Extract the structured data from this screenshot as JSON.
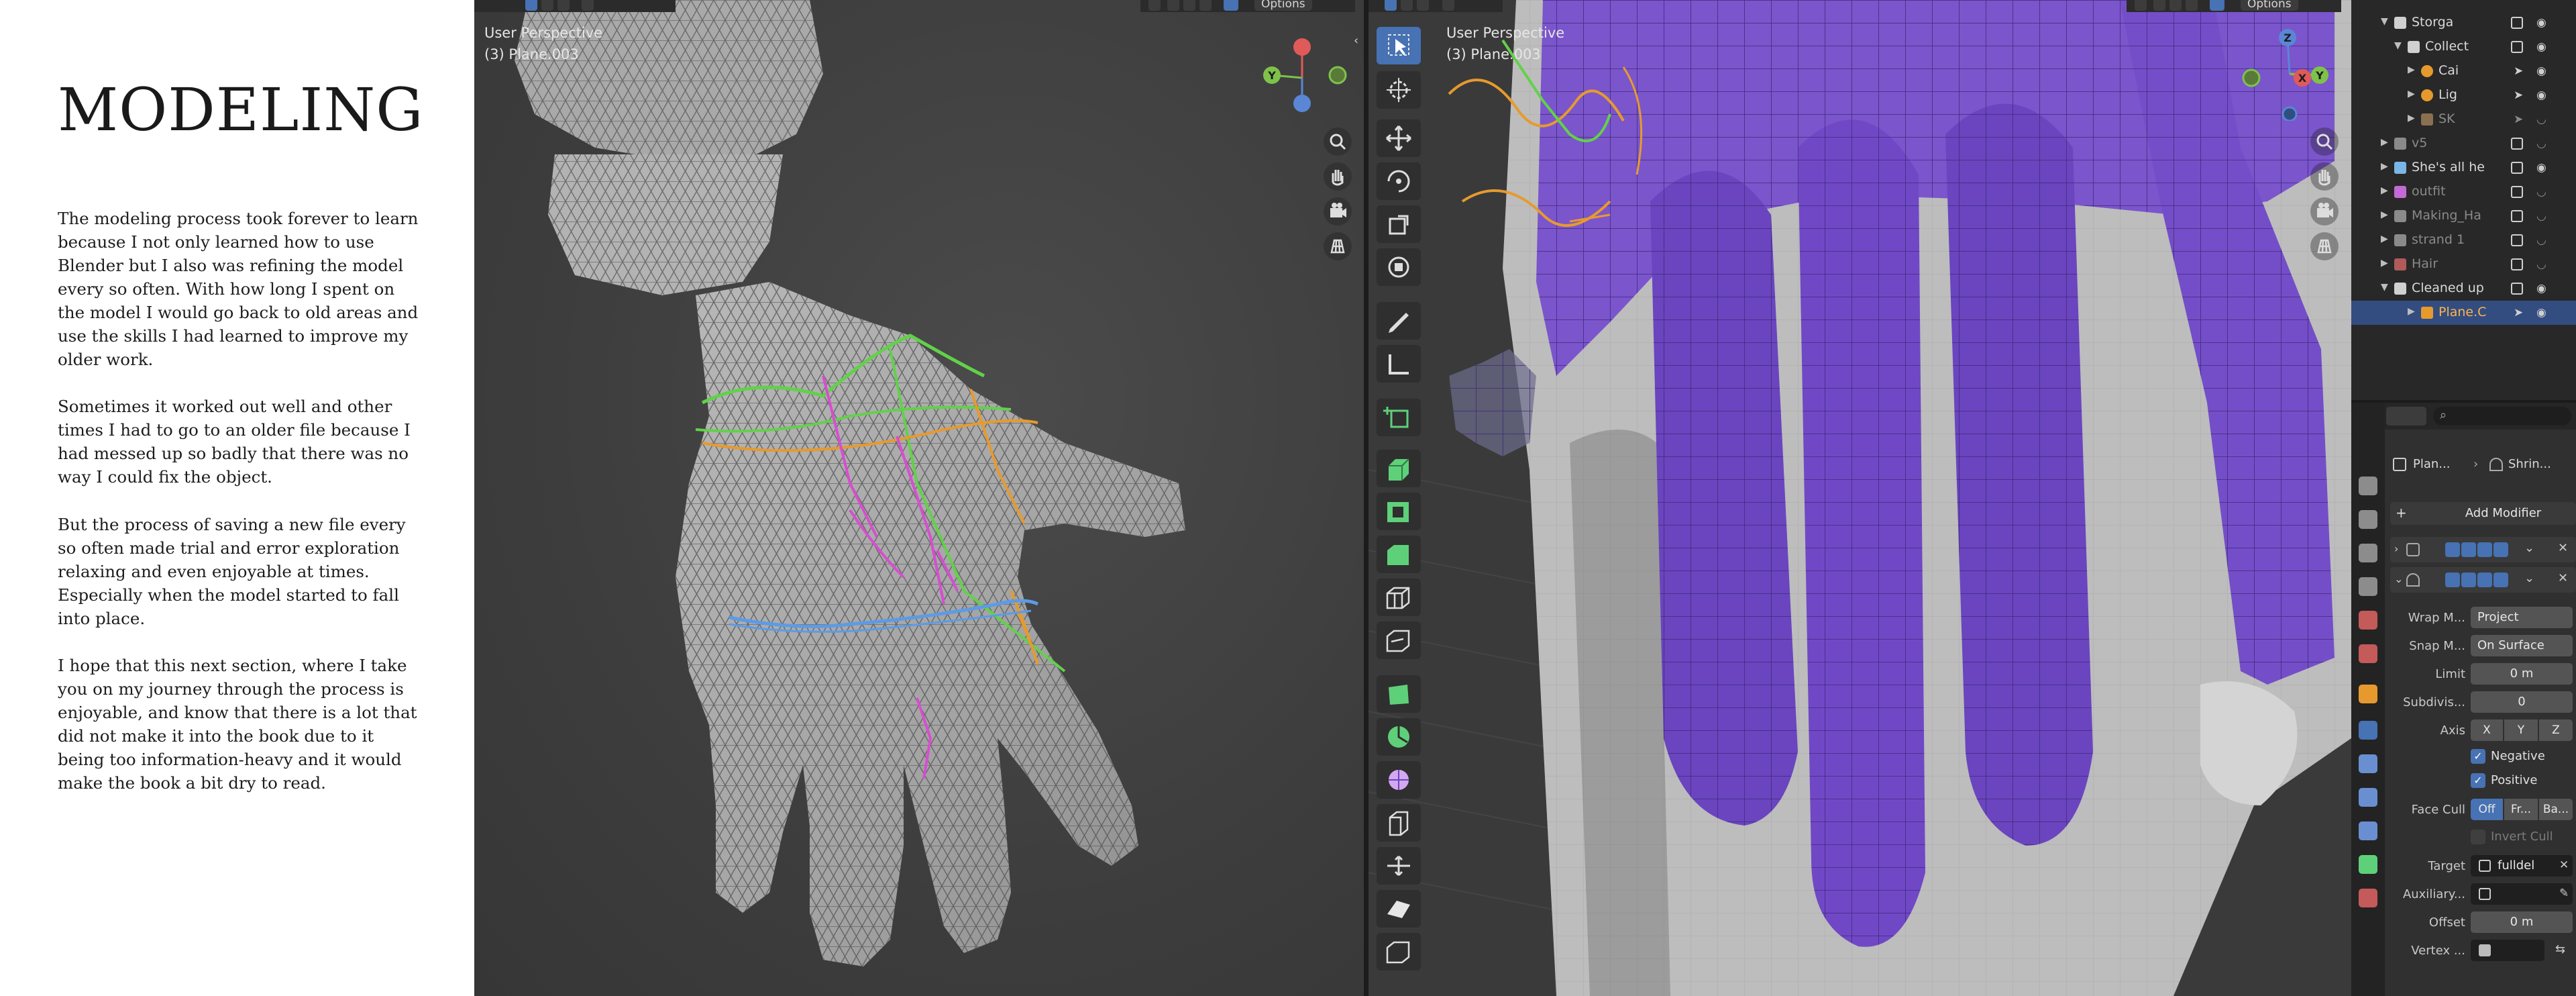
{
  "page": {
    "heading": "MODELING",
    "paragraphs": [
      "The modeling process took forever to learn because I not only learned how to use Blender but I also was refining the model every so often. With how long I spent on the model I would go back to old areas and use the skills I had learned to improve my older work.",
      "Sometimes it worked out well and other times I had to go to an older file because I had messed up so badly that there was no way I could fix the object.",
      "But the process of saving a new file every so often made trial and error exploration relaxing and even enjoyable at times. Especially when the model started to fall into place.",
      "I hope that this next section, where I take you on my journey through the process is enjoyable, and know that there is a lot that did not make it into the book due to it being too information-heavy and it would make the book a bit dry to read."
    ]
  },
  "viewport_left": {
    "perspective": "User Perspective",
    "object": "(3) Plane.003",
    "options_label": "Options",
    "gizmo_labels": {
      "y": "Y"
    }
  },
  "viewport_right": {
    "perspective": "User Perspective",
    "object": "(3) Plane.003",
    "options_label": "Options",
    "gizmo_labels": {
      "z": "Z",
      "x": "X",
      "y": "Y"
    }
  },
  "outliner": {
    "items": [
      {
        "label": "Storga",
        "color": "#d0d0d0"
      },
      {
        "label": "Collect",
        "color": "#d0d0d0"
      },
      {
        "label": "Cai",
        "color": "#e0e0e0"
      },
      {
        "label": "Lig",
        "color": "#e0e0e0"
      },
      {
        "label": "SK",
        "color": "#8a8a8a"
      },
      {
        "label": "v5",
        "color": "#8a8a8a"
      },
      {
        "label": "She's all he",
        "color": "#e0e0e0"
      },
      {
        "label": "outfit",
        "color": "#8a8a8a"
      },
      {
        "label": "Making_Ha",
        "color": "#8a8a8a"
      },
      {
        "label": "strand 1",
        "color": "#8a8a8a"
      },
      {
        "label": "Hair",
        "color": "#8a8a8a"
      },
      {
        "label": "Cleaned up",
        "color": "#e0e0e0"
      },
      {
        "label": "Plane.C",
        "color": "#ffb34d"
      }
    ]
  },
  "properties": {
    "breadcrumb_object": "Plan...",
    "breadcrumb_modifier": "Shrin...",
    "add_modifier": "Add Modifier",
    "fields": {
      "wrap_method_label": "Wrap M...",
      "wrap_method_value": "Project",
      "snap_mode_label": "Snap M...",
      "snap_mode_value": "On Surface",
      "limit_label": "Limit",
      "limit_value": "0 m",
      "subdiv_label": "Subdivis...",
      "subdiv_value": "0",
      "axis_label": "Axis",
      "axis_x": "X",
      "axis_y": "Y",
      "axis_z": "Z",
      "negative_label": "Negative",
      "positive_label": "Positive",
      "face_cull_label": "Face Cull",
      "face_cull_off": "Off",
      "face_cull_front": "Fr...",
      "face_cull_back": "Ba...",
      "invert_cull_label": "Invert Cull",
      "target_label": "Target",
      "target_value": "fulldel",
      "auxiliary_label": "Auxiliary...",
      "offset_label": "Offset",
      "offset_value": "0 m",
      "vertex_label": "Vertex ..."
    }
  },
  "colors": {
    "accent_blue": "#4772b3",
    "mesh_purple": "#6a45bf",
    "mesh_grey": "#9c9c9c",
    "curve_green": "#62d14a",
    "curve_orange": "#e69a2e",
    "curve_pink": "#d64ed0",
    "curve_blue": "#5c9be6"
  }
}
